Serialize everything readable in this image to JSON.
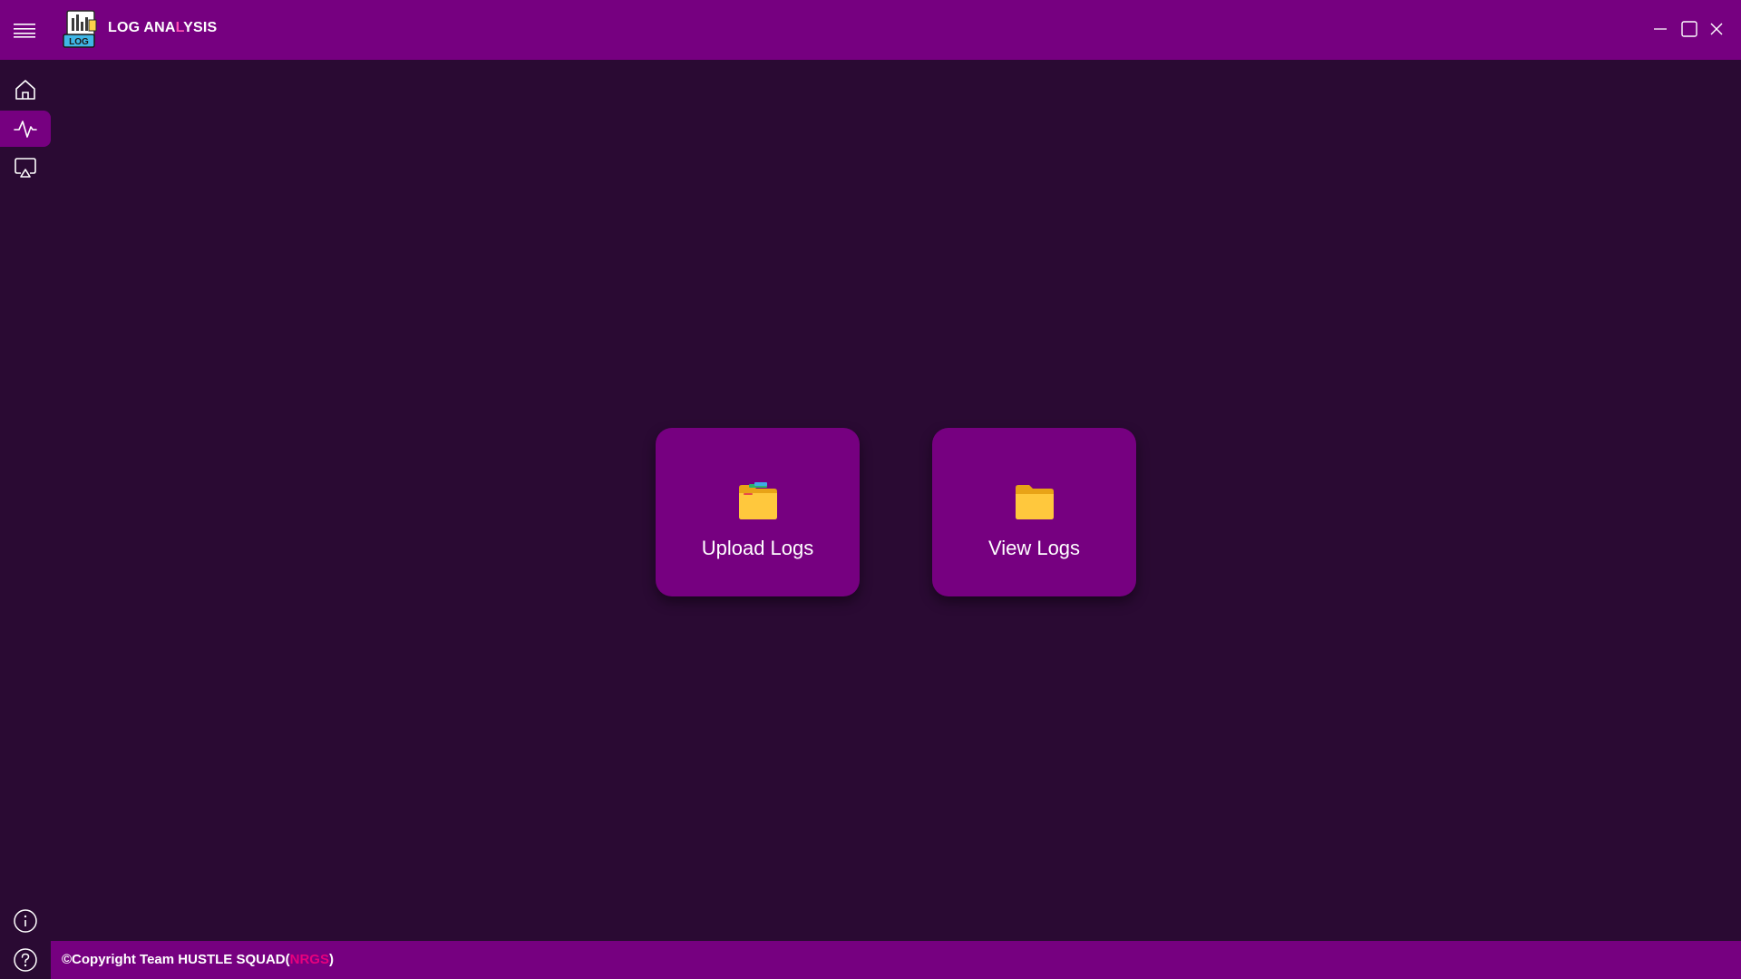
{
  "app": {
    "title_part1": "LOG ANA",
    "title_accent": "L",
    "title_part2": "YSIS",
    "logo_text": "LOG"
  },
  "titlebar": {
    "menu_icon": "hamburger-icon",
    "minimize_icon": "minimize-icon",
    "maximize_icon": "maximize-icon",
    "close_icon": "close-icon"
  },
  "sidebar": {
    "items": [
      {
        "icon": "home-icon",
        "active": false
      },
      {
        "icon": "activity-icon",
        "active": true
      },
      {
        "icon": "screen-share-icon",
        "active": false
      }
    ],
    "bottom": [
      {
        "icon": "info-icon"
      },
      {
        "icon": "help-icon"
      }
    ]
  },
  "main": {
    "tiles": [
      {
        "label": "Upload Logs",
        "icon": "open-folder-icon"
      },
      {
        "label": "View Logs",
        "icon": "folder-icon"
      }
    ]
  },
  "footer": {
    "text_prefix": "©Copyright Team HUSTLE SQUAD(",
    "text_accent": "NRGS",
    "text_suffix": ")"
  },
  "colors": {
    "background": "#2a0a33",
    "accent_purple": "#760080",
    "folder_yellow": "#ffc83d",
    "accent_pink": "#e6007e"
  }
}
